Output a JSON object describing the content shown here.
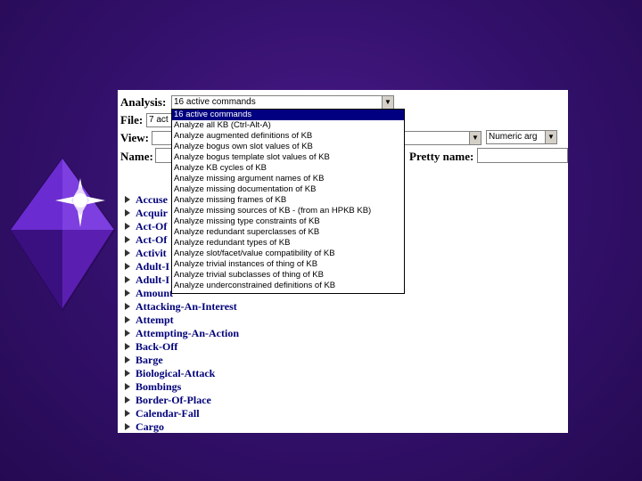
{
  "form": {
    "analysis_label": "Analysis:",
    "analysis_value": "16 active commands",
    "file_label": "File:",
    "file_value": "7 act",
    "view_label": "View:",
    "view_value": "",
    "view_mode_value": "Numeric arg",
    "name_label": "Name:",
    "pretty_name_label": "Pretty name:"
  },
  "dropdown": {
    "items": [
      "16 active commands",
      "Analyze all KB (Ctrl-Alt-A)",
      "Analyze augmented definitions of KB",
      "Analyze bogus own slot values of KB",
      "Analyze bogus template slot values of KB",
      "Analyze KB cycles of KB",
      "Analyze missing argument names of KB",
      "Analyze missing documentation of KB",
      "Analyze missing frames of KB",
      "Analyze missing sources of KB - (from an HPKB KB)",
      "Analyze missing type constraints of KB",
      "Analyze redundant superclasses of KB",
      "Analyze redundant types of KB",
      "Analyze slot/facet/value compatibility of KB",
      "Analyze trivial instances of thing of KB",
      "Analyze trivial subclasses of thing of KB",
      "Analyze underconstrained definitions of KB"
    ]
  },
  "list": {
    "items": [
      {
        "label": "Accuse"
      },
      {
        "label": "Acquir"
      },
      {
        "label": "Act-Of"
      },
      {
        "label": "Act-Of"
      },
      {
        "label": "Activit"
      },
      {
        "label": "Adult-I"
      },
      {
        "label": "Adult-I"
      },
      {
        "label": "Amount"
      },
      {
        "label": "Attacking-An-Interest"
      },
      {
        "label": "Attempt"
      },
      {
        "label": "Attempting-An-Action"
      },
      {
        "label": "Back-Off"
      },
      {
        "label": "Barge"
      },
      {
        "label": "Biological-Attack"
      },
      {
        "label": "Bombings"
      },
      {
        "label": "Border-Of-Place"
      },
      {
        "label": "Calendar-Fall"
      },
      {
        "label": "Cargo"
      }
    ]
  }
}
